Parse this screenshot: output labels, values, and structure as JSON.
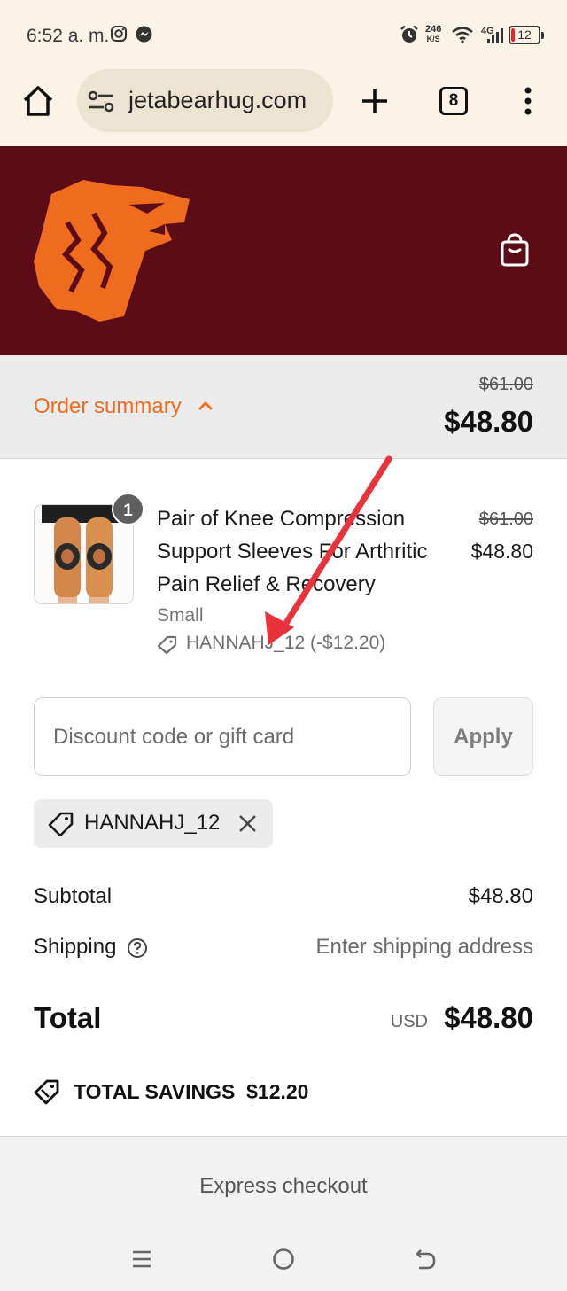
{
  "status_bar": {
    "time": "6:52 a. m.",
    "net_speed_value": "246",
    "net_speed_unit": "K/S",
    "network": "4G",
    "battery": "12"
  },
  "browser": {
    "url": "jetabearhug.com",
    "tab_count": "8"
  },
  "colors": {
    "brand_header": "#5c0c17",
    "accent_orange": "#ef6c1e",
    "annotation_arrow": "#e8323c"
  },
  "order_summary": {
    "toggle_label": "Order summary",
    "original_total": "$61.00",
    "total": "$48.80"
  },
  "product": {
    "quantity": "1",
    "title": "Pair of Knee Compression Support Sleeves For Arthritic Pain Relief & Recovery",
    "variant": "Small",
    "discount_line": "HANNAHJ_12 (-$12.20)",
    "original_price": "$61.00",
    "price": "$48.80"
  },
  "discount_form": {
    "placeholder": "Discount code or gift card",
    "apply_label": "Apply",
    "applied_code": "HANNAHJ_12"
  },
  "totals": {
    "subtotal_label": "Subtotal",
    "subtotal_value": "$48.80",
    "shipping_label": "Shipping",
    "shipping_value": "Enter shipping address",
    "total_label": "Total",
    "currency": "USD",
    "total_value": "$48.80",
    "savings_label": "TOTAL SAVINGS",
    "savings_value": "$12.20"
  },
  "express": {
    "label": "Express checkout"
  }
}
